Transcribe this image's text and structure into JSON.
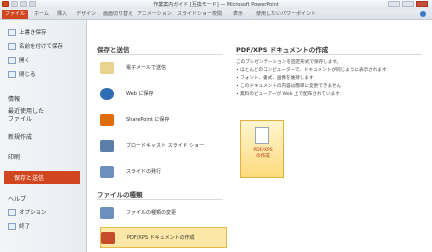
{
  "window": {
    "title": "作業案内ガイド [互換モード] — Microsoft PowerPoint"
  },
  "ribbon": {
    "file_tab": "ファイル",
    "tabs": [
      "ホーム",
      "挿入",
      "デザイン",
      "画面切り替え",
      "アニメーション",
      "スライドショー",
      "校閲",
      "表示",
      "使用したいパワーポイント"
    ]
  },
  "nav": {
    "items": [
      {
        "label": "上書き保存"
      },
      {
        "label": "名前を付けて保存"
      },
      {
        "label": "開く"
      },
      {
        "label": "閉じる"
      }
    ],
    "info": "情報",
    "recent": "最近使用した\nファイル",
    "new": "新規作成",
    "print": "印刷",
    "save_send": "保存と送信",
    "help": "ヘルプ",
    "options": "オプション",
    "exit": "終了"
  },
  "mid": {
    "section1": "保存と送信",
    "options": [
      {
        "label": "電子メールで送信",
        "color": "#e8d38f"
      },
      {
        "label": "Web に保存",
        "color": "#2e6db4"
      },
      {
        "label": "SharePoint に保存",
        "color": "#e36c0a"
      },
      {
        "label": "ブロードキャスト スライド ショー",
        "color": "#5b7fa8"
      },
      {
        "label": "スライドの発行",
        "color": "#6b8fbf"
      }
    ],
    "section2": "ファイルの種類",
    "file_options": [
      {
        "label": "ファイルの種類の変更",
        "color": "#6b8fbf"
      },
      {
        "label": "PDF/XPS ドキュメントの作成",
        "color": "#c54b2a"
      }
    ]
  },
  "right": {
    "title": "PDF/XPS ドキュメントの作成",
    "lines": [
      "このプレゼンテーションを固定形式で保存します。",
      "• ほとんどのコンピューターで、ドキュメントが同じように表示されます",
      "• フォント、書式、画像を維持します",
      "• このドキュメントの内容は簡単に変更できません",
      "• 無料のビューアーが Web 上で配布されています"
    ],
    "button_label": "PDF/XPS\nの作成"
  }
}
